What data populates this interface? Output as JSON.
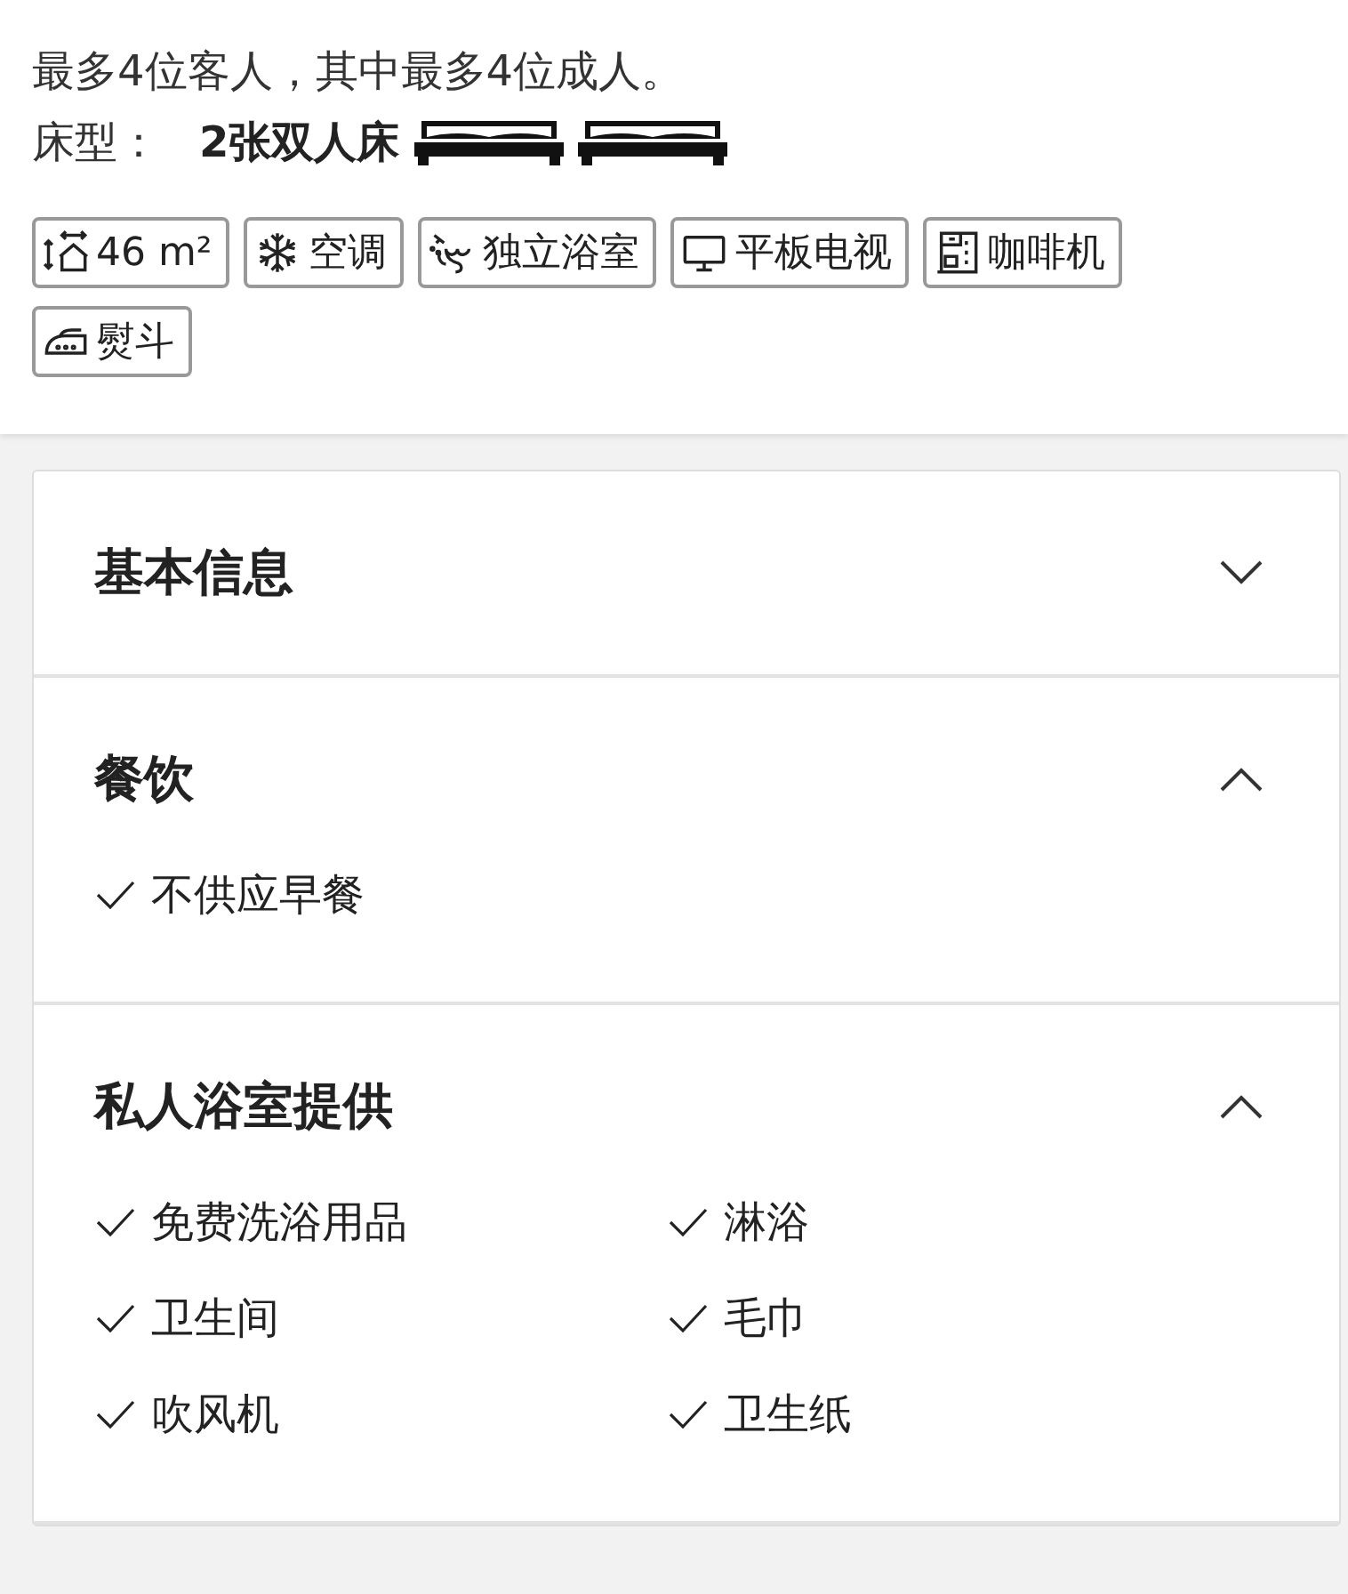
{
  "occupancy": "最多4位客人，其中最多4位成人。",
  "bed": {
    "label": "床型：",
    "value": "2张双人床",
    "icons": [
      {
        "kind": "bed"
      },
      {
        "kind": "bed"
      }
    ]
  },
  "facilities": [
    {
      "kind": "area",
      "label": "46 m²"
    },
    {
      "kind": "snowflake",
      "label": "空调"
    },
    {
      "kind": "shower",
      "label": "独立浴室"
    },
    {
      "kind": "tv",
      "label": "平板电视"
    },
    {
      "kind": "coffee",
      "label": "咖啡机"
    },
    {
      "kind": "iron",
      "label": "熨斗"
    }
  ],
  "sections": [
    {
      "title": "基本信息",
      "expanded": false
    },
    {
      "title": "餐饮",
      "expanded": true,
      "kind": "list",
      "items": [
        "不供应早餐"
      ]
    },
    {
      "title": "私人浴室提供",
      "expanded": true,
      "kind": "grid",
      "items": [
        "免费洗浴用品",
        "淋浴",
        "卫生间",
        "毛巾",
        "吹风机",
        "卫生纸"
      ]
    }
  ]
}
